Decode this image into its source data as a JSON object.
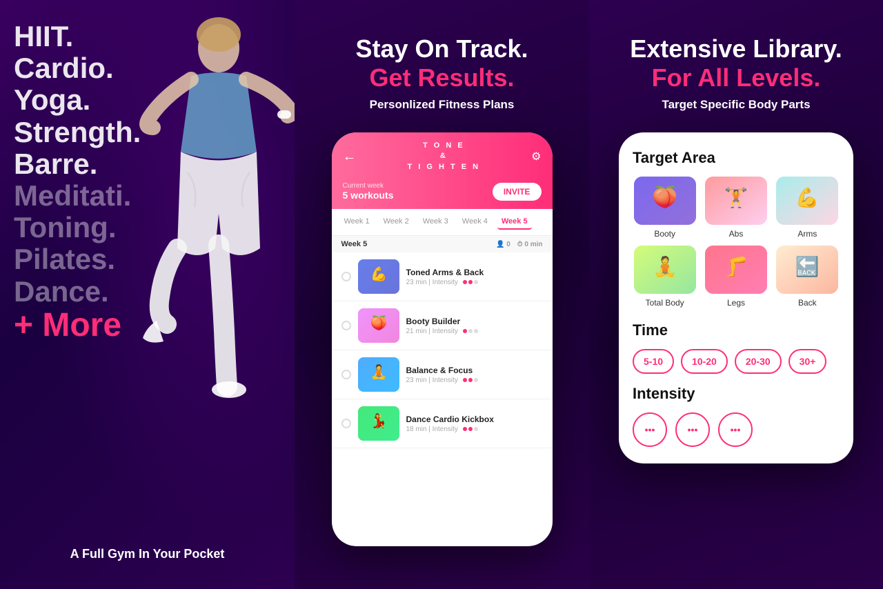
{
  "left_panel": {
    "workout_types": [
      {
        "label": "HIIT.",
        "style": "normal"
      },
      {
        "label": "Cardio.",
        "style": "normal"
      },
      {
        "label": "Yoga.",
        "style": "normal"
      },
      {
        "label": "Strength.",
        "style": "normal"
      },
      {
        "label": "Barre.",
        "style": "normal"
      },
      {
        "label": "Meditati.",
        "style": "dim"
      },
      {
        "label": "Toning.",
        "style": "dim"
      },
      {
        "label": "Pilates.",
        "style": "dim"
      },
      {
        "label": "Dance.",
        "style": "dim"
      },
      {
        "label": "+ More",
        "style": "pink"
      }
    ],
    "tagline": "A Full Gym In Your Pocket"
  },
  "middle_panel": {
    "headline_line1": "Stay On Track.",
    "headline_line2": "Get Results.",
    "subheadline": "Personlized Fitness Plans",
    "phone": {
      "app_name_line1": "T O N E",
      "app_name_line2": "&",
      "app_name_line3": "T I G H T E N",
      "current_week_label": "Current week",
      "workouts_count": "5 workouts",
      "invite_button": "INVITE",
      "week_tabs": [
        "Week 1",
        "Week 2",
        "Week 3",
        "Week 4",
        "Week 5"
      ],
      "active_week": "Week 5",
      "week_section": "Week 5",
      "stats_people": "0",
      "stats_time": "0 min",
      "workouts": [
        {
          "name": "Toned Arms & Back",
          "duration": "23 min",
          "intensity_label": "Intensity",
          "intensity": 2,
          "thumb_style": "arms"
        },
        {
          "name": "Booty Builder",
          "duration": "21 min",
          "intensity_label": "Intensity",
          "intensity": 1,
          "thumb_style": "booty"
        },
        {
          "name": "Balance & Focus",
          "duration": "23 min",
          "intensity_label": "Intensity",
          "intensity": 2,
          "thumb_style": "balance"
        },
        {
          "name": "Dance Cardio Kickbox",
          "duration": "18 min",
          "intensity_label": "Intensity",
          "intensity": 2,
          "thumb_style": "dance"
        }
      ]
    }
  },
  "right_panel": {
    "headline_line1": "Extensive Library.",
    "headline_line2": "For All Levels.",
    "subheadline": "Target Specific Body Parts",
    "phone": {
      "target_area_title": "Target Area",
      "body_parts": [
        {
          "label": "Booty",
          "style": "booty"
        },
        {
          "label": "Abs",
          "style": "abs"
        },
        {
          "label": "Arms",
          "style": "arms"
        },
        {
          "label": "Total Body",
          "style": "total"
        },
        {
          "label": "Legs",
          "style": "legs"
        },
        {
          "label": "Back",
          "style": "back"
        }
      ],
      "time_title": "Time",
      "time_buttons": [
        "5-10",
        "10-20",
        "20-30",
        "30+"
      ],
      "intensity_title": "Intensity",
      "intensity_options": [
        "•••",
        "•••",
        "•••"
      ]
    }
  }
}
